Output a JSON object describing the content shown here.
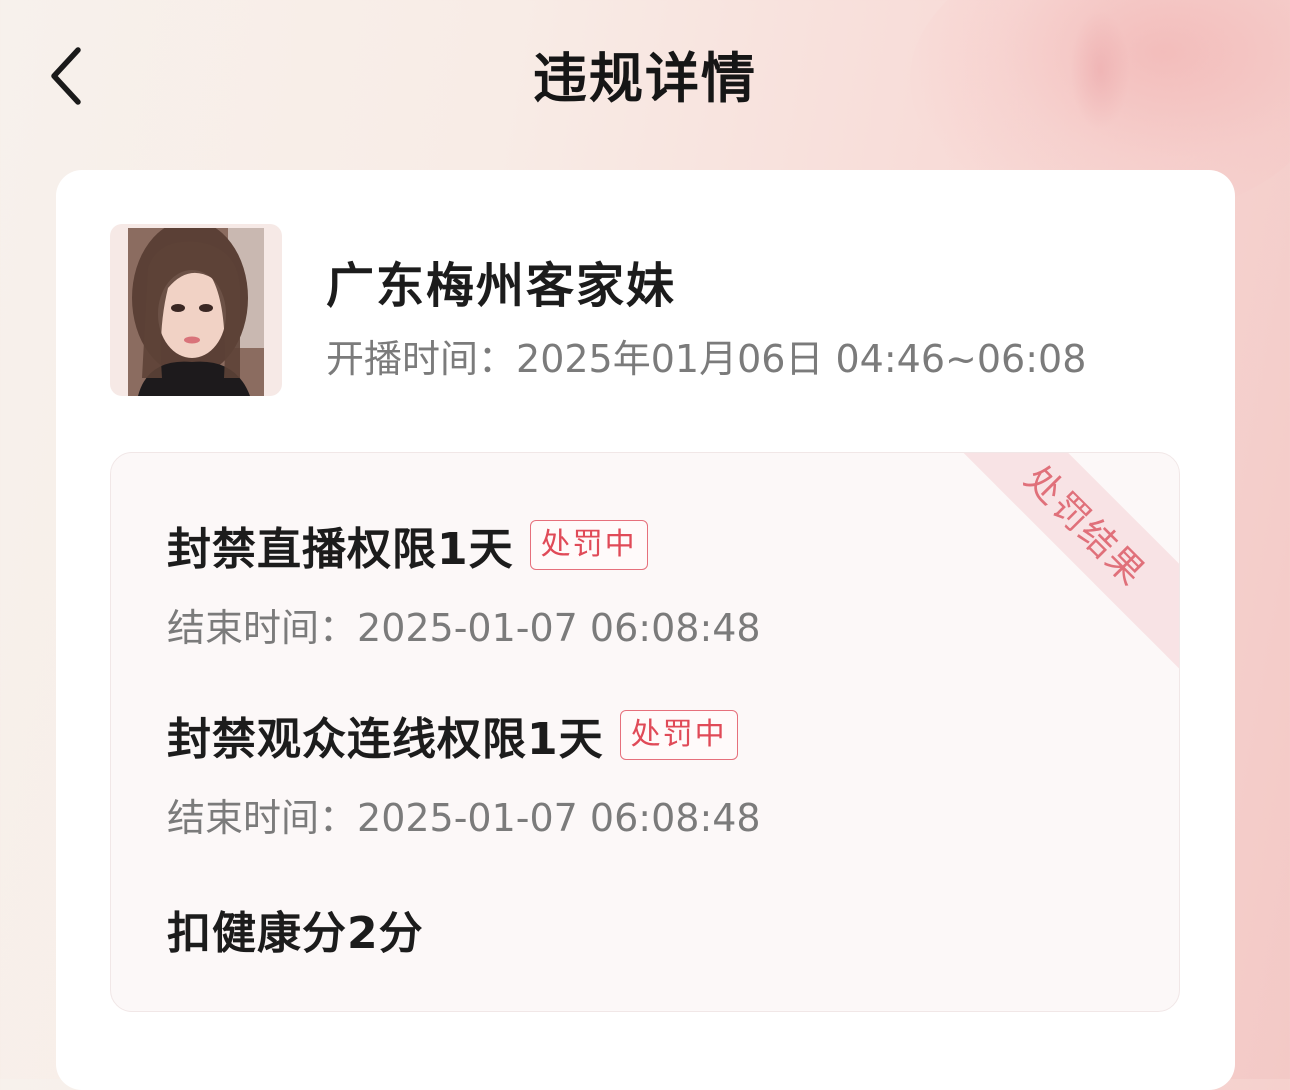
{
  "header": {
    "title": "违规详情",
    "back_icon": "chevron-left-icon"
  },
  "streamer": {
    "name": "广东梅州客家妹",
    "stream_time_label": "开播时间：",
    "stream_time_value": "2025年01月06日 04:46~06:08"
  },
  "result": {
    "ribbon_label": "处罚结果",
    "penalties": [
      {
        "title": "封禁直播权限1天",
        "status": "处罚中",
        "end_label": "结束时间：",
        "end_value": "2025-01-07 06:08:48"
      },
      {
        "title": "封禁观众连线权限1天",
        "status": "处罚中",
        "end_label": "结束时间：",
        "end_value": "2025-01-07 06:08:48"
      }
    ],
    "health_deduction": "扣健康分2分"
  },
  "colors": {
    "status_red": "#e04a58",
    "ribbon_bg": "#f8e3e5",
    "ribbon_text": "#e0707a"
  }
}
